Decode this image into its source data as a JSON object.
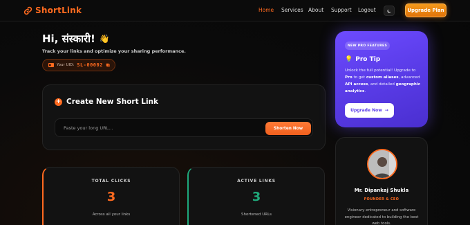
{
  "nav": {
    "brand": "ShortLink",
    "links": [
      "Home",
      "Services",
      "About",
      "Support",
      "Logout"
    ],
    "active": "Home",
    "upgrade_label": "Upgrade Plan"
  },
  "hero": {
    "greeting": "Hi, संस्कारी!",
    "wave": "👋",
    "subtitle": "Track your links and optimize your sharing performance.",
    "uid_label": "Your UID:",
    "uid_value": "SL-00002"
  },
  "create": {
    "title": "Create New Short Link",
    "placeholder": "Paste your long URL...",
    "button_label": "Shorten Now"
  },
  "stats": [
    {
      "label": "TOTAL CLICKS",
      "value": "3",
      "caption": "Across all your links",
      "color": "#ff6a1f"
    },
    {
      "label": "ACTIVE LINKS",
      "value": "3",
      "caption": "Shortened URLs",
      "color": "#1fa97a"
    }
  ],
  "tip": {
    "badge": "NEW PRO FEATURES",
    "heading": "Pro Tip",
    "body_1": "Unlock the full potential! Upgrade to ",
    "body_pro": "Pro",
    "body_2": " to get ",
    "body_aliases": "custom aliases",
    "body_3": ", advanced ",
    "body_api": "API access",
    "body_4": ", and detailed ",
    "body_geo": "geographic analytics",
    "body_5": ".",
    "button_label": "Upgrade Now"
  },
  "profile": {
    "name": "Mr. Dipankaj Shukla",
    "role": "FOUNDER & CEO",
    "bio": "Visionary entrepreneur and software engineer dedicated to building the best web tools."
  },
  "colors": {
    "accent": "#ff6a1f",
    "purple": "#5a3ce8",
    "green": "#1fa97a"
  }
}
